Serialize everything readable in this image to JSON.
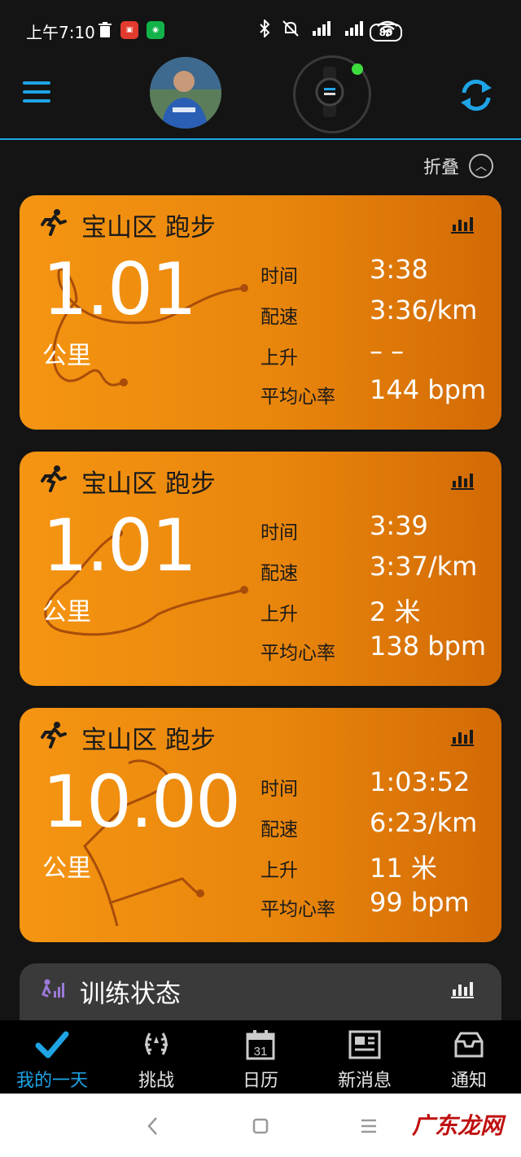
{
  "status_bar": {
    "time": "上午7:10",
    "battery": "80"
  },
  "header": {
    "fold_label": "折叠"
  },
  "cards": [
    {
      "title": "宝山区 跑步",
      "distance": "1.01",
      "unit": "公里",
      "stats": [
        {
          "label": "时间",
          "value": "3:38"
        },
        {
          "label": "配速",
          "value": "3:36/km"
        },
        {
          "label": "上升",
          "value": "– –"
        },
        {
          "label": "平均心率",
          "value": "144 bpm"
        }
      ]
    },
    {
      "title": "宝山区 跑步",
      "distance": "1.01",
      "unit": "公里",
      "stats": [
        {
          "label": "时间",
          "value": "3:39"
        },
        {
          "label": "配速",
          "value": "3:37/km"
        },
        {
          "label": "上升",
          "value": "2 米"
        },
        {
          "label": "平均心率",
          "value": "138 bpm"
        }
      ]
    },
    {
      "title": "宝山区 跑步",
      "distance": "10.00",
      "unit": "公里",
      "stats": [
        {
          "label": "时间",
          "value": "1:03:52"
        },
        {
          "label": "配速",
          "value": "6:23/km"
        },
        {
          "label": "上升",
          "value": "11 米"
        },
        {
          "label": "平均心率",
          "value": "99 bpm"
        }
      ]
    }
  ],
  "training_status": {
    "title": "训练状态"
  },
  "bottom_nav": [
    {
      "label": "我的一天"
    },
    {
      "label": "挑战"
    },
    {
      "label": "日历"
    },
    {
      "label": "新消息"
    },
    {
      "label": "通知"
    }
  ],
  "calendar_day": "31",
  "watermark": "广东龙网",
  "colors": {
    "accent": "#1fa4e6",
    "card_orange": "#f59512",
    "route_color": "#a84d0a"
  }
}
